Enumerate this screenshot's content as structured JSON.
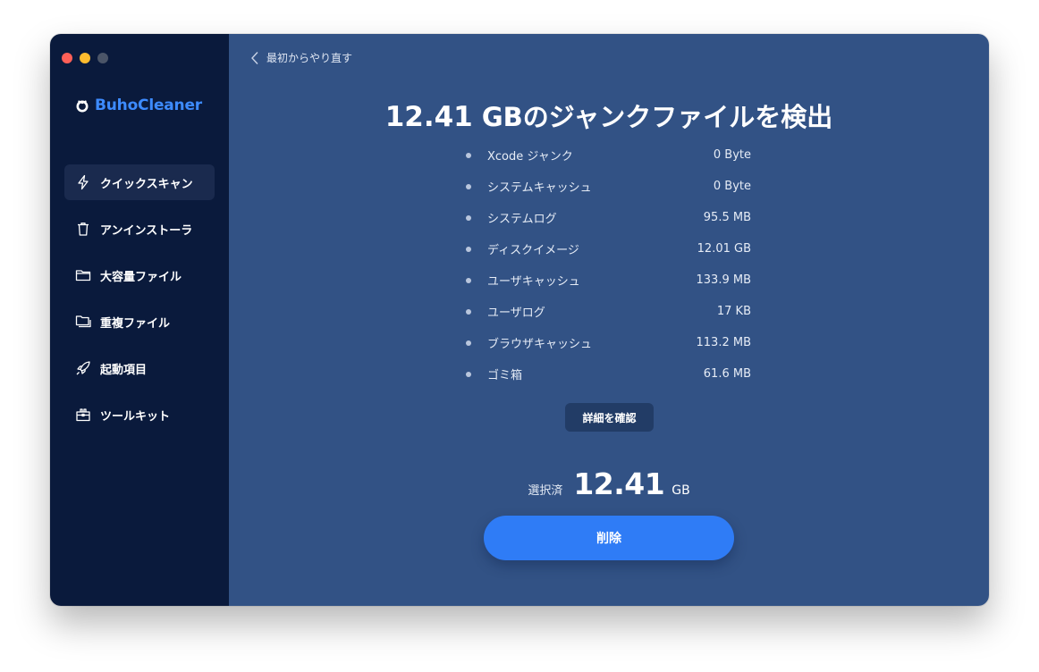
{
  "app": {
    "brand_name": "BuhoCleaner",
    "colors": {
      "sidebar_bg": "#0a1a3c",
      "main_bg": "#325285",
      "accent": "#2f7cf6",
      "brand": "#3d8bff"
    }
  },
  "sidebar": {
    "items": [
      {
        "label": "クイックスキャン",
        "icon": "lightning-icon",
        "active": true
      },
      {
        "label": "アンインストーラ",
        "icon": "trash-icon",
        "active": false
      },
      {
        "label": "大容量ファイル",
        "icon": "folder-icon",
        "active": false
      },
      {
        "label": "重複ファイル",
        "icon": "duplicate-folder-icon",
        "active": false
      },
      {
        "label": "起動項目",
        "icon": "rocket-icon",
        "active": false
      },
      {
        "label": "ツールキット",
        "icon": "toolbox-icon",
        "active": false
      }
    ]
  },
  "main": {
    "back_label": "最初からやり直す",
    "headline_number": "12.41",
    "headline_text": " GBのジャンクファイルを検出",
    "items": [
      {
        "label": "Xcode ジャンク",
        "size": "0 Byte"
      },
      {
        "label": "システムキャッシュ",
        "size": "0 Byte"
      },
      {
        "label": "システムログ",
        "size": "95.5 MB"
      },
      {
        "label": "ディスクイメージ",
        "size": "12.01 GB"
      },
      {
        "label": "ユーザキャッシュ",
        "size": "133.9 MB"
      },
      {
        "label": "ユーザログ",
        "size": "17 KB"
      },
      {
        "label": "ブラウザキャッシュ",
        "size": "113.2 MB"
      },
      {
        "label": "ゴミ箱",
        "size": "61.6 MB"
      }
    ],
    "details_button": "詳細を確認",
    "selected_label": "選択済",
    "selected_value": "12.41",
    "selected_unit": "GB",
    "delete_button": "削除"
  }
}
